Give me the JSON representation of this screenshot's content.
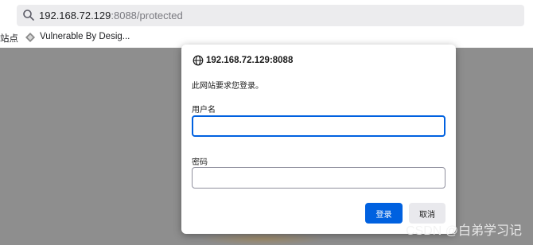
{
  "address_bar": {
    "host": "192.168.72.129",
    "rest": ":8088/protected"
  },
  "bookmarks": {
    "truncated_item": "站点",
    "item_label": "Vulnerable By Desig..."
  },
  "auth_dialog": {
    "host": "192.168.72.129:8088",
    "message": "此网站要求您登录。",
    "username_label": "用户名",
    "username_value": "",
    "password_label": "密码",
    "password_value": "",
    "login_button": "登录",
    "cancel_button": "取消"
  },
  "watermark": "CSDN @白弟学习记",
  "colors": {
    "accent": "#0061e0",
    "backdrop": "#8e8e8e"
  }
}
